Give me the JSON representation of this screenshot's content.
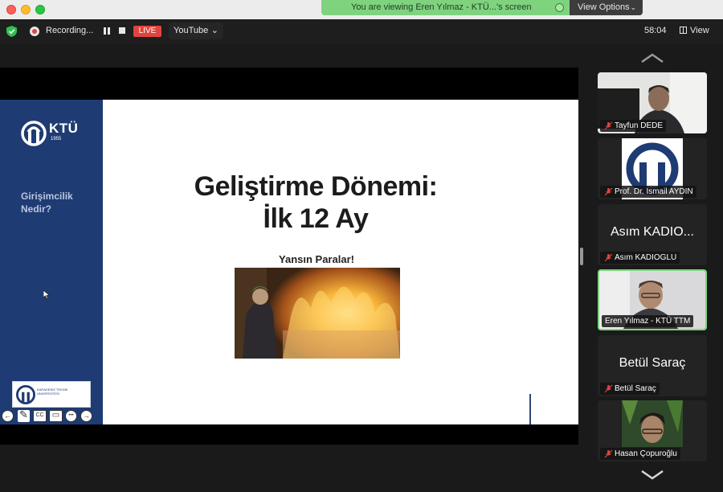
{
  "window": {
    "viewing_banner": "You are viewing Eren Yılmaz - KTÜ...'s screen",
    "view_options_label": "View Options",
    "view_options_chevron": "⌄"
  },
  "topbar": {
    "recording_label": "Recording...",
    "live_badge": "LIVE",
    "stream_target": "YouTube",
    "stream_chevron": "⌄",
    "timer": "58:04",
    "view_label": "View"
  },
  "slide": {
    "logo_text": "KTÜ",
    "logo_year": "1955",
    "sidebar_heading": "Girişimcilik Nedir?",
    "title_line1": "Geliştirme Dönemi:",
    "title_line2": "İlk 12 Ay",
    "subtitle": "Yansın Paralar!",
    "footer_logo_text": "KARADENİZ TEKNİK ÜNİVERSİTESİ",
    "controls": {
      "prev": "←",
      "pen": "✎",
      "cc": "CC",
      "camera": "▭",
      "more": "•••",
      "next": "→"
    }
  },
  "participants": [
    {
      "name": "Tayfun DEDE",
      "has_video": true,
      "muted": true
    },
    {
      "name": "Prof. Dr. Ismail AYDIN",
      "has_video": true,
      "muted": true
    },
    {
      "name": "Asım KADIOGLU",
      "display_name": "Asım KADIO...",
      "has_video": false,
      "muted": true
    },
    {
      "name": "Eren Yılmaz - KTÜ TTM",
      "has_video": true,
      "muted": false,
      "active_speaker": true
    },
    {
      "name": "Betül Saraç",
      "display_name": "Betül Saraç",
      "has_video": false,
      "muted": true
    },
    {
      "name": "Hasan Çopuroğlu",
      "has_video": true,
      "muted": true
    }
  ],
  "colors": {
    "live_red": "#e0443e",
    "banner_green": "#7fd37f",
    "slide_blue": "#1f3b73",
    "active_border": "#7ed57e",
    "mute_red": "#e0443e"
  }
}
